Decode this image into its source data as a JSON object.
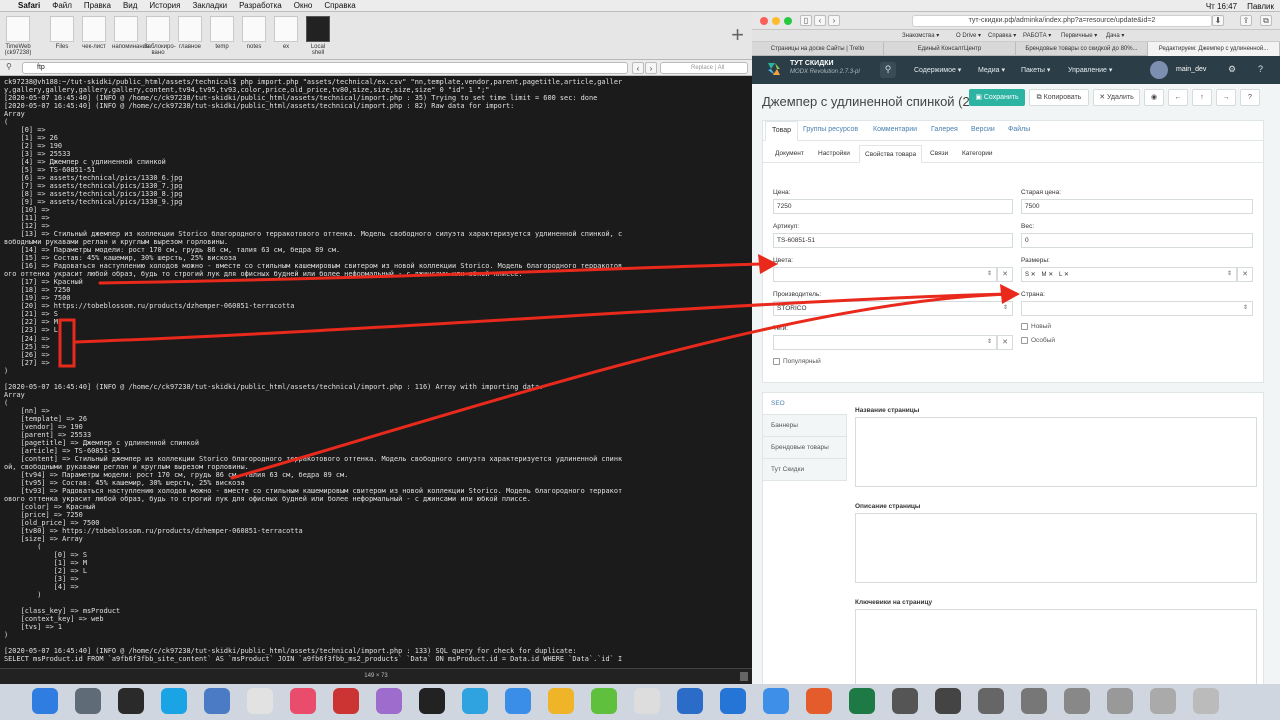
{
  "menubar": {
    "items": [
      "Safari",
      "Файл",
      "Правка",
      "Вид",
      "История",
      "Закладки",
      "Разработка",
      "Окно",
      "Справка"
    ],
    "right": [
      "Чт 16:47",
      "Павлик"
    ]
  },
  "shelf": {
    "tiles": [
      "TimeWeb (ck97238)",
      "Files",
      "чек-лист",
      "напоминание",
      "Заблокиро­вано",
      "главное",
      "temp",
      "notes",
      "ex",
      "Local shell"
    ]
  },
  "findbar": {
    "query": "ftp",
    "replace_placeholder": "Replace",
    "all_label": "All"
  },
  "terminal": {
    "lines": [
      "ck97238@vh188:~/tut-skidki/public_html/assets/technical$ php import.php \"assets/technical/ex.csv\" \"nn,template,vendor,parent,pagetitle,article,galler",
      "y,gallery,gallery,gallery,gallery,content,tv94,tv95,tv93,color,price,old_price,tv80,size,size,size,size\" 0 \"id\" 1 \";\"",
      "[2020-05-07 16:45:40] (INFO @ /home/c/ck97238/tut-skidki/public_html/assets/technical/import.php : 35) Trying to set time limit = 600 sec: done",
      "[2020-05-07 16:45:40] (INFO @ /home/c/ck97238/tut-skidki/public_html/assets/technical/import.php : 82) Raw data for import:",
      "Array",
      "(",
      "    [0] =>",
      "    [1] => 26",
      "    [2] => 190",
      "    [3] => 25533",
      "    [4] => Джемпер с удлиненной спинкой",
      "    [5] => TS-60851-51",
      "    [6] => assets/technical/pics/1330_6.jpg",
      "    [7] => assets/technical/pics/1330_7.jpg",
      "    [8] => assets/technical/pics/1330_8.jpg",
      "    [9] => assets/technical/pics/1330_9.jpg",
      "    [10] =>",
      "    [11] =>",
      "    [12] =>",
      "    [13] => Стильный джемпер из коллекции Storico благородного терракотового оттенка. Модель свободного силуэта характеризуется удлиненной спинкой, с",
      "вободными рукавами реглан и круглым вырезом горловины.",
      "    [14] => Параметры модели: рост 170 см, грудь 86 см, талия 63 см, бедра 89 см.",
      "    [15] => Состав: 45% кашемир, 30% шерсть, 25% вискоза",
      "    [16] => Радоваться наступлению холодов можно - вместе со стильным кашемировым свитером из новой коллекции Storico. Модель благородного терракотов",
      "ого оттенка украсит любой образ, будь то строгий лук для офисных будней или более неформальный - с джинсами или юбкой плиссе.",
      "    [17] => Красный",
      "    [18] => 7250",
      "    [19] => 7500",
      "    [20] => https://tobeblossom.ru/products/dzhemper-060851-terracotta",
      "    [21] => S",
      "    [22] => M",
      "    [23] => L",
      "    [24] =>",
      "    [25] =>",
      "    [26] =>",
      "    [27] =>",
      ")",
      "",
      "[2020-05-07 16:45:40] (INFO @ /home/c/ck97238/tut-skidki/public_html/assets/technical/import.php : 116) Array with importing data:",
      "Array",
      "(",
      "    [nn] =>",
      "    [template] => 26",
      "    [vendor] => 190",
      "    [parent] => 25533",
      "    [pagetitle] => Джемпер с удлиненной спинкой",
      "    [article] => TS-60851-51",
      "    [content] => Стильный джемпер из коллекции Storico благородного терракотового оттенка. Модель свободного силуэта характеризуется удлиненной спинк",
      "ой, свободными рукавами реглан и круглым вырезом горловины.",
      "    [tv94] => Параметры модели: рост 170 см, грудь 86 см, талия 63 см, бедра 89 см.",
      "    [tv95] => Состав: 45% кашемир, 30% шерсть, 25% вискоза",
      "    [tv93] => Радоваться наступлению холодов можно - вместе со стильным кашемировым свитером из новой коллекции Storico. Модель благородного терракот",
      "ового оттенка украсит любой образ, будь то строгий лук для офисных будней или более неформальный - с джинсами или юбкой плиссе.",
      "    [color] => Красный",
      "    [price] => 7250",
      "    [old_price] => 7500",
      "    [tv80] => https://tobeblossom.ru/products/dzhemper-060851-terracotta",
      "    [size] => Array",
      "        (",
      "            [0] => S",
      "            [1] => M",
      "            [2] => L",
      "            [3] =>",
      "            [4] =>",
      "        )",
      "",
      "    [class_key] => msProduct",
      "    [context_key] => web",
      "    [tvs] => 1",
      ")",
      "",
      "[2020-05-07 16:45:40] (INFO @ /home/c/ck97238/tut-skidki/public_html/assets/technical/import.php : 133) SQL query for check for duplicate:",
      "SELECT msProduct.id FROM `a9fb6f3fbb_site_content` AS `msProduct` JOIN `a9fb6f3fbb_ms2_products` `Data` ON msProduct.id = Data.id WHERE `Data`.`id` I"
    ],
    "status": "149 × 73"
  },
  "browser": {
    "url": "тут-скидки.рф/adminka/index.php?a=resource/update&id=2",
    "favorites": [
      "Знакомства ▾",
      "О Drive ▾",
      "Справка ▾",
      "РАБОТА ▾",
      "Первичные ▾",
      "Дача ▾"
    ],
    "tabs": [
      "Страницы на доске Сайты | Trello",
      "Единый КонсалтЦентр",
      "Брендовые товары со скидкой до 80%...",
      "Редактируем: Джемпер с удлиненной..."
    ]
  },
  "modx": {
    "brand": "ТУТ СКИДКИ",
    "version": "MODX Revolution 2.7.3-pl",
    "nav": [
      "Содержимое ▾",
      "Медиа ▾",
      "Пакеты ▾",
      "Управление ▾"
    ],
    "user": "main_dev",
    "title": "Джемпер с удлиненной спинкой (2",
    "save": "Сохранить",
    "copy": "Копировать",
    "delete": "Удалить",
    "tabs": [
      "Товар",
      "Группы ресурсов",
      "Комментарии",
      "Галерея",
      "Версии",
      "Файлы"
    ],
    "subtabs": [
      "Документ",
      "Настройки",
      "Свойства товара",
      "Связи",
      "Категории"
    ],
    "form": {
      "price_label": "Цена:",
      "price": "7250",
      "old_price_label": "Старая цена:",
      "old_price": "7500",
      "article_label": "Артикул:",
      "article": "TS-60851-51",
      "weight_label": "Вес:",
      "weight": "0",
      "color_label": "Цвета:",
      "sizes_label": "Размеры:",
      "sizes": [
        "S",
        "M",
        "L"
      ],
      "vendor_label": "Производитель:",
      "vendor": "STORICO",
      "country_label": "Страна:",
      "tags_label": "Теги:",
      "new_label": "Новый",
      "special_label": "Особый",
      "popular_label": "Популярный"
    },
    "seo": {
      "vtabs": [
        "SEO",
        "Баннеры",
        "Брендовые товары",
        "Тут Скидки"
      ],
      "page_title_label": "Название страницы",
      "page_desc_label": "Описание страницы",
      "keywords_label": "Ключевики на страницу"
    }
  },
  "dock": {
    "colors": [
      "#2f7de1",
      "#606b78",
      "#2a2a2a",
      "#1aa3e5",
      "#4a7bc4",
      "#e2e2e2",
      "#ea4c6b",
      "#c33",
      "#9d6ccc",
      "#222",
      "#2fa3e0",
      "#3b8ee8",
      "#f0b429",
      "#5fc03d",
      "#ddd",
      "#2b6cc9",
      "#2575d6",
      "#3e8fe8",
      "#e55c2c",
      "#1d7a45",
      "#555",
      "#444",
      "#666",
      "#777",
      "#888",
      "#999",
      "#aaa",
      "#bbb"
    ]
  }
}
